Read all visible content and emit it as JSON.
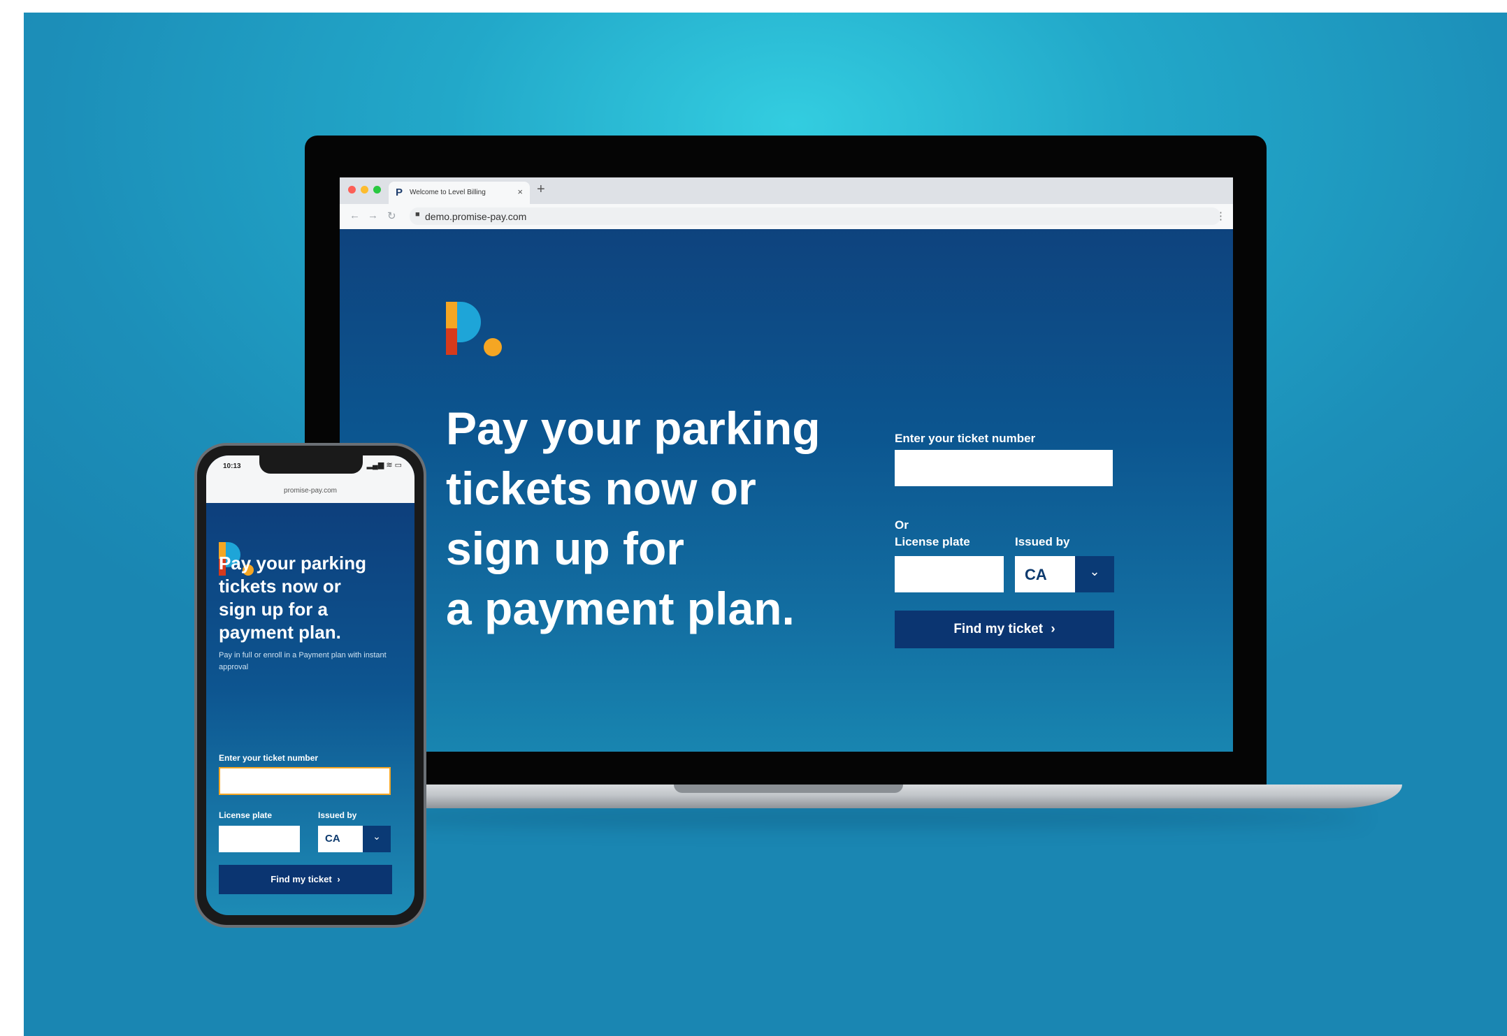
{
  "laptop": {
    "tab_title": "Welcome to Level Billing",
    "tab_favicon": "P",
    "url": "demo.promise-pay.com",
    "headline_lines": [
      "Pay your parking",
      "tickets now or",
      "sign up for",
      "a payment plan."
    ],
    "form": {
      "ticket_label": "Enter your ticket number",
      "ticket_value": "",
      "or_label": "Or",
      "plate_label": "License plate",
      "plate_value": "",
      "issued_label": "Issued by",
      "issued_value": "CA",
      "button_label": "Find my ticket"
    }
  },
  "phone": {
    "time": "10:13",
    "signal": "▂▄▆ ≋ ▭",
    "url": "promise-pay.com",
    "headline_lines": [
      "Pay your parking",
      "tickets now or",
      "sign up for a",
      "payment plan."
    ],
    "subtext": "Pay in full or enroll in a Payment plan with instant approval",
    "form": {
      "ticket_label": "Enter your ticket number",
      "plate_label": "License plate",
      "issued_label": "Issued by",
      "issued_value": "CA",
      "button_label": "Find my ticket"
    }
  },
  "icons": {
    "chevron_down": "⌄",
    "chevron_right": "›",
    "lock": "🔒",
    "back": "←",
    "forward": "→",
    "reload": "↻",
    "close": "×",
    "plus": "+",
    "kebab": "⋮"
  },
  "colors": {
    "brand_orange": "#f5a623",
    "brand_red": "#d63a1c",
    "brand_blue": "#1ea5d8",
    "button_navy": "#0b3571"
  }
}
